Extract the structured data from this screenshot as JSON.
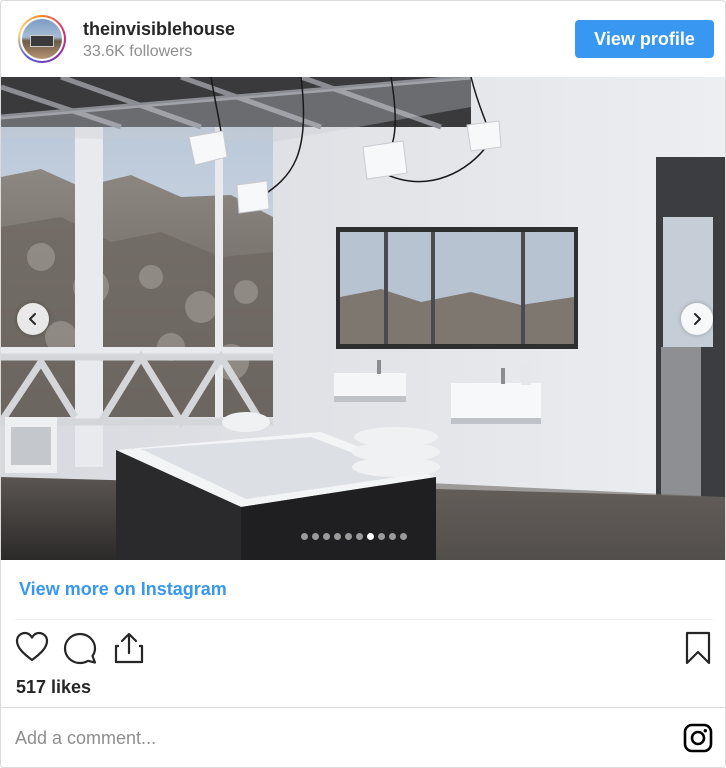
{
  "post": {
    "username": "theinvisiblehouse",
    "followers": "33.6K followers",
    "view_profile_label": "View profile"
  },
  "carousel": {
    "image_alt": "",
    "total_slides": 10,
    "active_slide": 7
  },
  "footer": {
    "view_more_label": "View more on Instagram",
    "likes": "517 likes",
    "comment_placeholder": "Add a comment..."
  },
  "icons": {
    "like": "heart-icon",
    "comment": "comment-icon",
    "share": "share-icon",
    "save": "bookmark-icon",
    "brand": "instagram-icon",
    "prev": "chevron-left-icon",
    "next": "chevron-right-icon"
  },
  "colors": {
    "accent": "#3897f0",
    "text": "#262626",
    "muted": "#8e8e8e",
    "border": "#dbdbdb"
  }
}
